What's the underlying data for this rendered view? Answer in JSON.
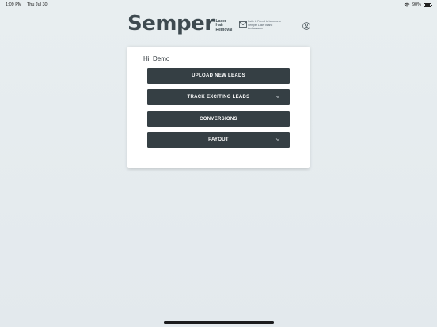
{
  "status_bar": {
    "time": "1:09 PM",
    "date": "Thu Jul 30",
    "battery": "90%"
  },
  "header": {
    "logo_word": "Semper",
    "logo_reg": "®",
    "logo_sub": [
      "Laser",
      "Hair",
      "Removal"
    ],
    "mail_text": [
      "Invite & Friend to become a",
      "Semper Laser Brand",
      "Ambassador"
    ]
  },
  "card": {
    "greeting": "Hi, Demo",
    "buttons": [
      {
        "label": "UPLOAD NEW LEADS",
        "has_chevron": false
      },
      {
        "label": "TRACK EXCITING LEADS",
        "has_chevron": true
      },
      {
        "label": "CONVERSIONS",
        "has_chevron": false
      },
      {
        "label": "PAYOUT",
        "has_chevron": true
      }
    ]
  },
  "colors": {
    "background": "#e6ecef",
    "button": "#353f44",
    "button_text": "#ffffff",
    "card": "#ffffff",
    "logo": "#3e4a50"
  },
  "icons": [
    "wifi-icon",
    "battery-icon",
    "mail-icon",
    "user-icon",
    "chevron-down-icon"
  ]
}
